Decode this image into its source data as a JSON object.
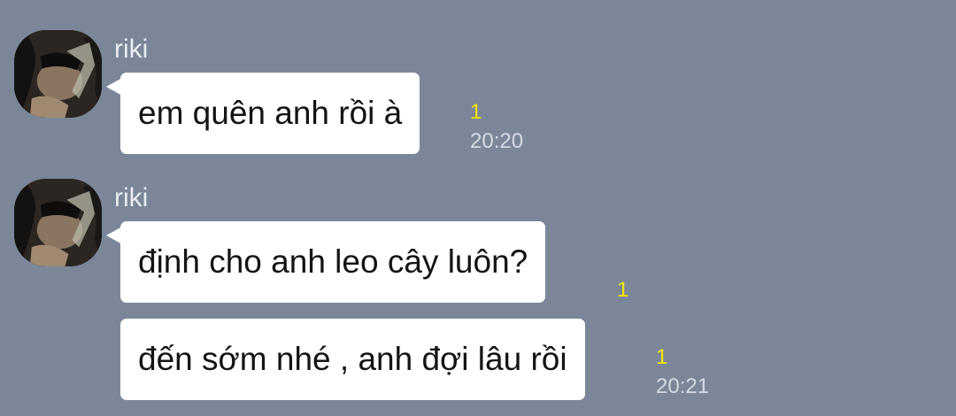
{
  "messages": [
    {
      "sender": "riki",
      "avatar_icon": "profile-photo",
      "bubbles": [
        {
          "text": "em quên anh rồi à",
          "read_count": "1",
          "time": "20:20"
        }
      ]
    },
    {
      "sender": "riki",
      "avatar_icon": "profile-photo",
      "bubbles": [
        {
          "text": "định cho anh leo cây luôn?",
          "read_count": "1",
          "time": ""
        },
        {
          "text": "đến sớm nhé , anh đợi lâu rồi",
          "read_count": "1",
          "time": "20:21"
        }
      ]
    }
  ],
  "colors": {
    "background": "#7b8799",
    "bubble": "#ffffff",
    "read_count": "#f3e600",
    "timestamp": "#d4d9e1",
    "sender_name": "#e9edf3"
  }
}
